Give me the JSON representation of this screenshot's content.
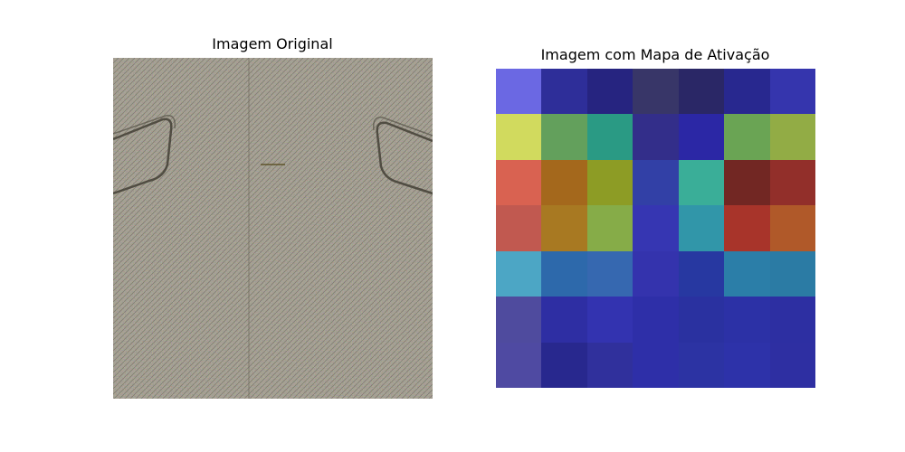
{
  "left_panel": {
    "title": "Imagem Original"
  },
  "right_panel": {
    "title": "Imagem com Mapa de Ativação",
    "grid": [
      [
        "#6b68e3",
        "#2e2e99",
        "#262480",
        "#383668",
        "#2a2766",
        "#28288f",
        "#3535ad"
      ],
      [
        "#d1da5e",
        "#63a05c",
        "#2a9a84",
        "#332e8a",
        "#2b27a5",
        "#6aa454",
        "#92ac45"
      ],
      [
        "#d96251",
        "#a4681c",
        "#8d9c25",
        "#3240a6",
        "#3aae98",
        "#722723",
        "#922f2a"
      ],
      [
        "#c15950",
        "#a87922",
        "#86ac48",
        "#3636b2",
        "#3196a9",
        "#a8342a",
        "#b05929"
      ],
      [
        "#4ca6c5",
        "#2d69ab",
        "#3668b0",
        "#3433ad",
        "#2738a1",
        "#2b7ea8",
        "#2b7ba4"
      ],
      [
        "#4f4b9e",
        "#2e2ea3",
        "#3333b0",
        "#2e2fa8",
        "#2a31a0",
        "#2c31a6",
        "#2d2fa2"
      ],
      [
        "#4f4aa2",
        "#28288e",
        "#30309c",
        "#2e2fa8",
        "#2c33a3",
        "#2d32a9",
        "#2e2fa2"
      ]
    ]
  }
}
